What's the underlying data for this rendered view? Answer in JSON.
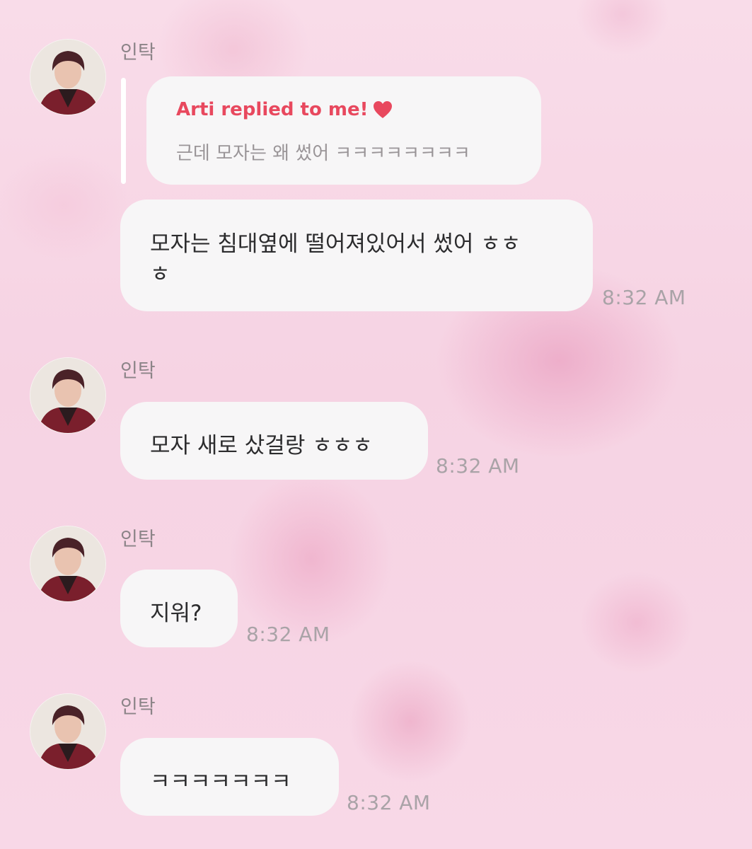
{
  "messages": [
    {
      "sender": "인탁",
      "reply": {
        "title": "Arti replied to me!",
        "icon": "heart-icon",
        "quoted_text": "근데 모자는 왜 썼어 ㅋㅋㅋㅋㅋㅋㅋㅋ"
      },
      "text_line1": "모자는 침대옆에 떨어져있어서 썼어 ㅎㅎ",
      "text_line2": "ㅎ",
      "time": "8:32 AM"
    },
    {
      "sender": "인탁",
      "text": "모자 새로 샀걸랑 ㅎㅎㅎ",
      "time": "8:32 AM"
    },
    {
      "sender": "인탁",
      "text": "지워?",
      "time": "8:32 AM"
    },
    {
      "sender": "인탁",
      "text": "ㅋㅋㅋㅋㅋㅋㅋ",
      "time": "8:32 AM"
    }
  ],
  "colors": {
    "reply_accent": "#e8485e",
    "bubble": "#f7f6f7",
    "background": "#f7d7e6",
    "timestamp": "#a9a3a7"
  }
}
